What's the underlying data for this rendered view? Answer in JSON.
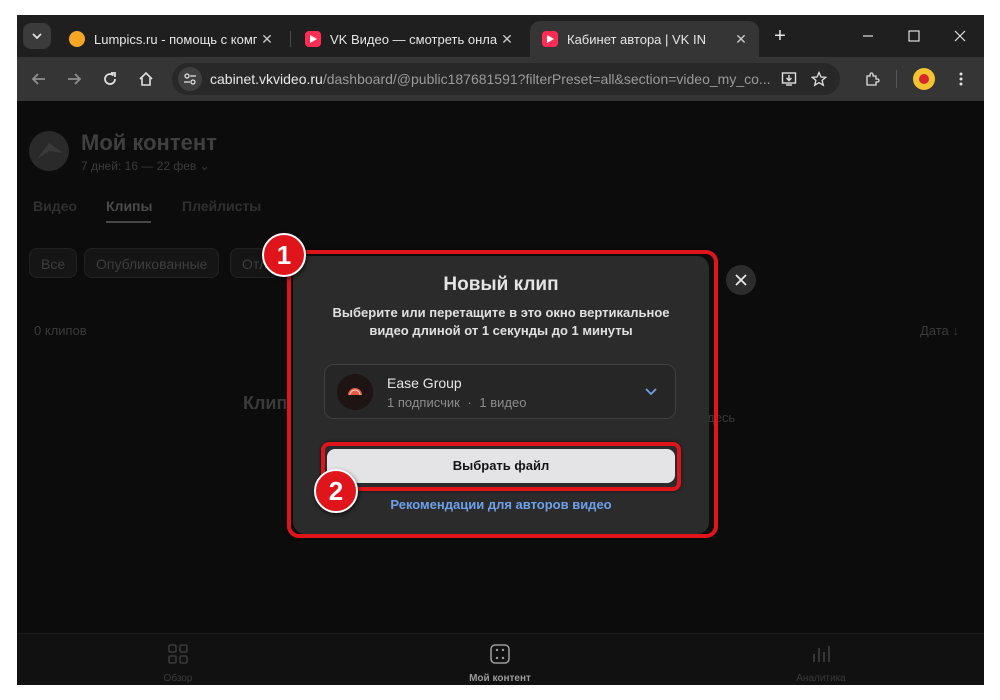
{
  "browser": {
    "tabs": [
      {
        "title": "Lumpics.ru - помощь с компь",
        "active": false
      },
      {
        "title": "VK Видео — смотреть онлайн",
        "active": false
      },
      {
        "title": "Кабинет автора | VK IN",
        "active": true
      }
    ],
    "new_tab_label": "+",
    "url_host": "cabinet.vkvideo.ru",
    "url_path": "/dashboard/@public187681591?filterPreset=all&section=video_my_co..."
  },
  "page": {
    "title": "Мой контент",
    "date_range": "7 дней: 16 — 22 фев",
    "tabs": [
      "Видео",
      "Клипы",
      "Плейлисты"
    ],
    "selected_tab": "Клипы",
    "filters": [
      "Все",
      "Опубликованные",
      "Отл"
    ],
    "count": "0 клипов",
    "sort": "Дата",
    "empty_left": "Клип",
    "empty_right": "десь"
  },
  "bottom_nav": {
    "overview": "Обзор",
    "my_content": "Мой контент",
    "analytics": "Аналитика"
  },
  "modal": {
    "title": "Новый клип",
    "description": "Выберите или перетащите в это окно вертикальное видео длиной от 1 секунды до 1 минуты",
    "channel": {
      "name": "Ease Group",
      "subscribers": "1 подписчик",
      "separator": "·",
      "videos": "1 видео"
    },
    "choose_file": "Выбрать файл",
    "recommendations_link": "Рекомендации для авторов видео"
  },
  "annotations": {
    "badge1": "1",
    "badge2": "2",
    "highlight_color": "#e0141b"
  },
  "colors": {
    "link": "#6ea0e8",
    "modal_bg": "#2b2b2c",
    "button_bg": "#e4e4e6"
  }
}
